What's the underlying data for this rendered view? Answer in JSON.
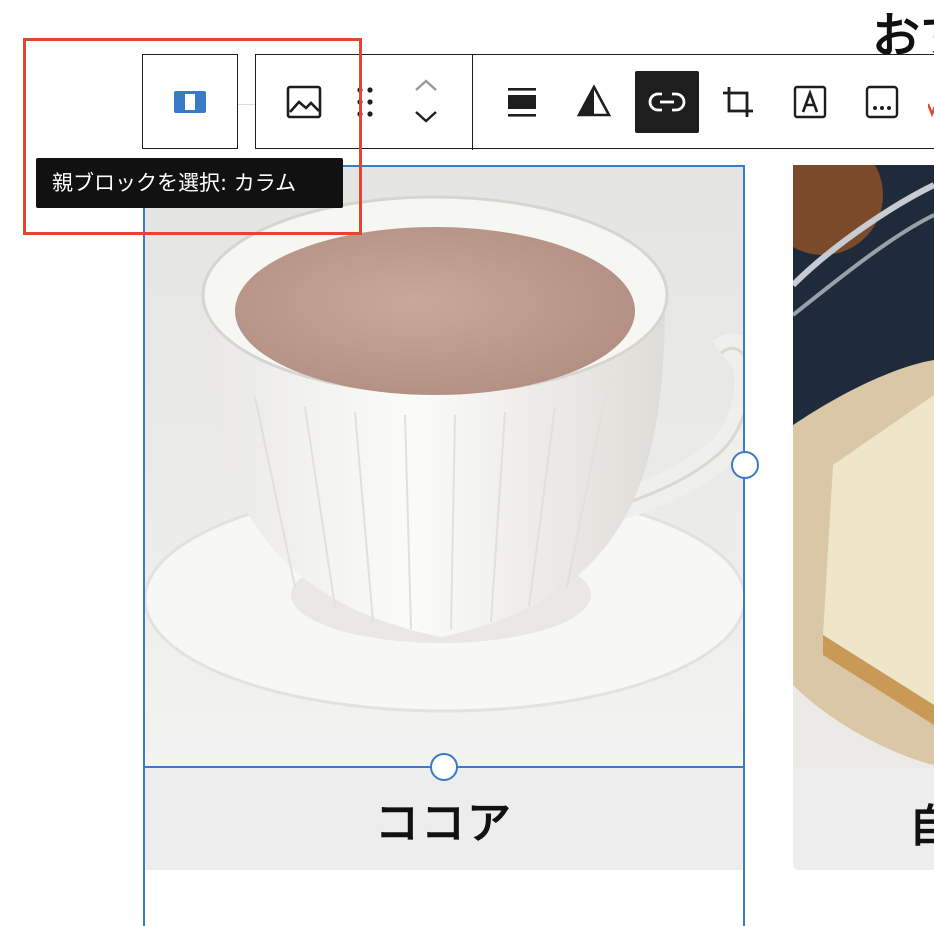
{
  "page": {
    "heading_peek": "おす",
    "columns": [
      {
        "caption": "ココア"
      },
      {
        "caption": "自"
      }
    ]
  },
  "toolbar": {
    "parent_button": {
      "icon": "columns-icon",
      "label": "親ブロックを選択: カラム"
    },
    "buttons": [
      {
        "icon": "image-icon"
      },
      {
        "icon": "drag-handle-icon"
      },
      {
        "icon": "move-up-icon"
      },
      {
        "icon": "move-down-icon"
      },
      {
        "icon": "align-icon"
      },
      {
        "icon": "duotone-icon"
      },
      {
        "icon": "link-icon",
        "active": true
      },
      {
        "icon": "crop-icon"
      },
      {
        "icon": "text-overlay-icon"
      },
      {
        "icon": "alt-text-icon"
      }
    ]
  },
  "tooltip": {
    "text": "親ブロックを選択: カラム"
  },
  "colors": {
    "selection": "#3a7bc8",
    "focus": "#e0472d",
    "toolbar_border": "#1e1e1e",
    "tooltip_bg": "#111111"
  }
}
